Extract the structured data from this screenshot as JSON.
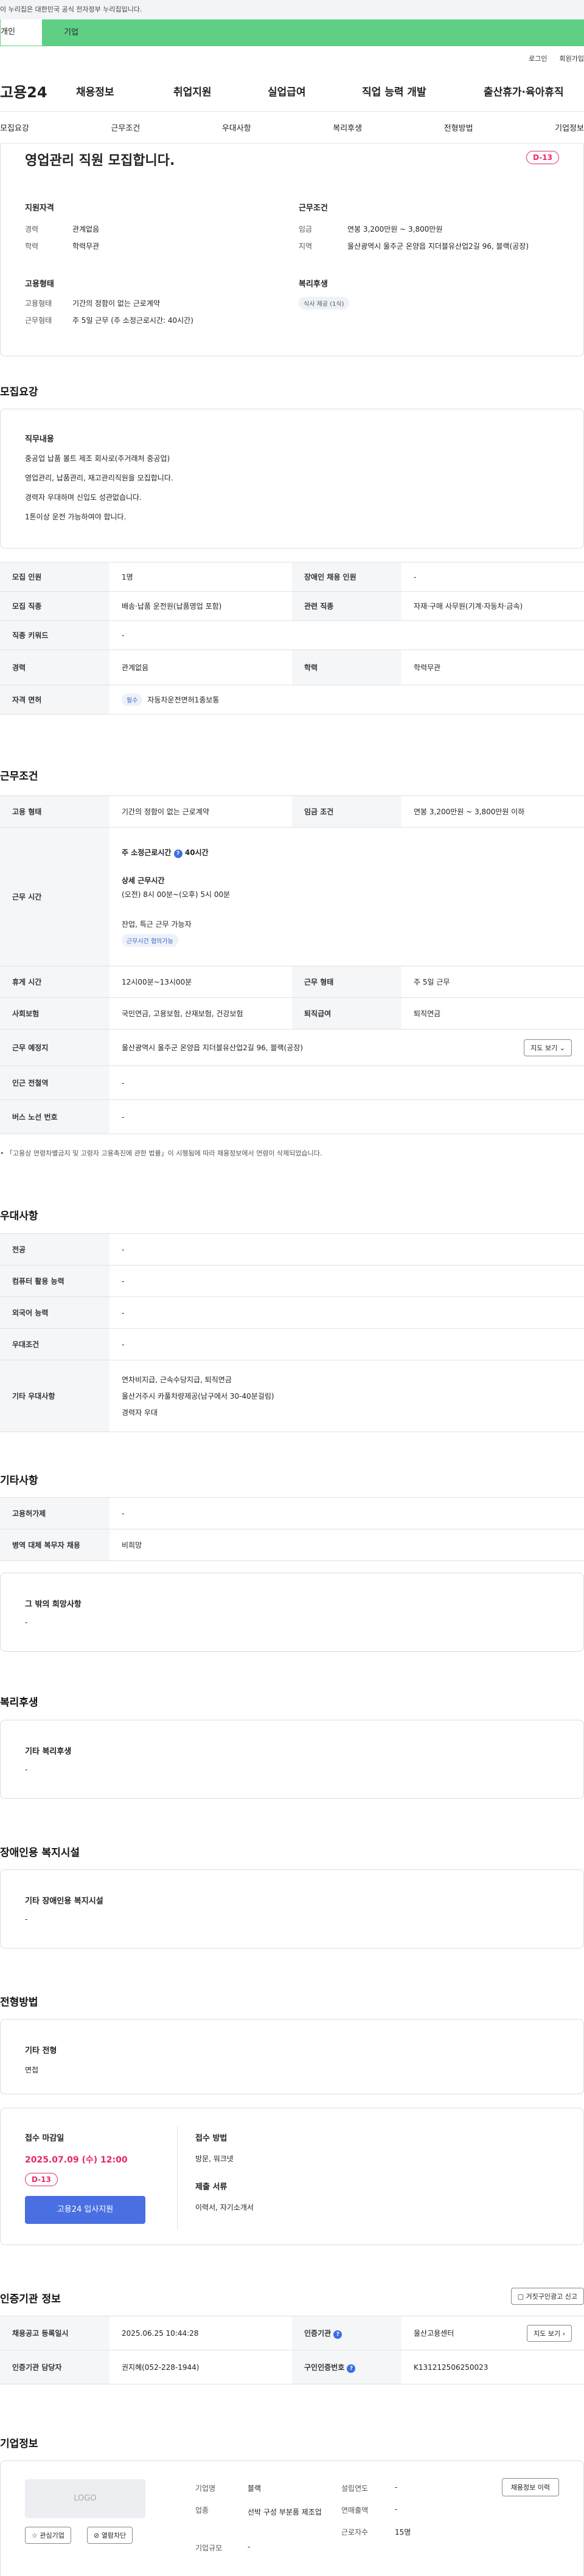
{
  "notice": "이 누리집은 대한민국 공식 전자정부 누리집입니다.",
  "user_tabs": {
    "individual": "개인",
    "enterprise": "기업"
  },
  "util": {
    "login": "로그인",
    "join": "회원가입"
  },
  "logo": "고용24",
  "gnb": [
    "채용정보",
    "취업지원",
    "실업급여",
    "직업 능력 개발",
    "출산휴가·육아휴직"
  ],
  "subnav": [
    "모집요강",
    "근무조건",
    "우대사항",
    "복리후생",
    "전형방법",
    "기업정보"
  ],
  "summary": {
    "title": "영업관리 직원 모집합니다.",
    "dday": "D-13",
    "qual_title": "지원자격",
    "qual": [
      {
        "k": "경력",
        "v": "관계없음"
      },
      {
        "k": "학력",
        "v": "학력무관"
      }
    ],
    "cond_title": "근무조건",
    "cond": [
      {
        "k": "임금",
        "v": "연봉 3,200만원 ~ 3,800만원"
      },
      {
        "k": "지역",
        "v": "울산광역시 울주군 온양읍 지더블유산업2길 96, 블랙(공장)"
      }
    ],
    "emp_title": "고용형태",
    "emp": [
      {
        "k": "고용형태",
        "v": "기간의 정함이 없는 근로계약"
      },
      {
        "k": "근무형태",
        "v": "주 5일 근무 (주 소정근로시간: 40시간)"
      }
    ],
    "welfare_title": "복리후생",
    "welfare_chip": "식사 제공 (1식)"
  },
  "recruit": {
    "title": "모집요강",
    "duty_title": "직무내용",
    "duty_lines": [
      "중공업 납품 볼트 제조 회사로(주거래처 중공업)",
      "영업관리, 납품관리, 재고관리직원을 모집합니다.",
      "경력자 우대하며 신입도 성관없습니다.",
      "1톤이상 운전 가능하여야 합니다."
    ],
    "rows": {
      "count_k": "모집 인원",
      "count_v": "1명",
      "disabled_k": "장애인 채용 인원",
      "disabled_v": "-",
      "job_k": "모집 직종",
      "job_v": "배송·납품 운전원(납품영업 포함)",
      "rel_k": "관련 직종",
      "rel_v": "자재·구매 사무원(기계·자동차·금속)",
      "kw_k": "직종 키워드",
      "kw_v": "-",
      "career_k": "경력",
      "career_v": "관계없음",
      "edu_k": "학력",
      "edu_v": "학력무관",
      "lic_k": "자격 면허",
      "lic_chip": "필수",
      "lic_v": "자동차운전면허1종보통"
    }
  },
  "work": {
    "title": "근무조건",
    "emp_k": "고용 형태",
    "emp_v": "기간의 정함이 없는 근로계약",
    "wage_k": "임금 조건",
    "wage_v": "연봉 3,200만원 ~ 3,800만원 이하",
    "time_k": "근무 시간",
    "time_main": "주 소정근로시간",
    "time_hours": "40시간",
    "time_detail_title": "상세 근무시간",
    "time_detail": "(오전) 8시 00분~(오후) 5시 00분",
    "time_extra": "잔업, 특근 근무 가능자",
    "time_chip": "근무시간 협의가능",
    "break_k": "휴게 시간",
    "break_v": "12시00분~13시00분",
    "form_k": "근무 형태",
    "form_v": "주 5일 근무",
    "ins_k": "사회보험",
    "ins_v": "국민연금, 고용보험, 산재보험, 건강보험",
    "ret_k": "퇴직급여",
    "ret_v": "퇴직연금",
    "loc_k": "근무 예정지",
    "loc_v": "울산광역시 울주군 온양읍 지더블유산업2길 96, 블랙(공장)",
    "map_btn": "지도 보기",
    "sub_k": "인근 전철역",
    "sub_v": "-",
    "bus_k": "버스 노선 번호",
    "bus_v": "-",
    "note": "「고용상 연령차별금지 및 고령자 고용촉진에 관한 법률」이 시행됨에 따라 채용정보에서 연령이 삭제되었습니다."
  },
  "pref": {
    "title": "우대사항",
    "major_k": "전공",
    "major_v": "-",
    "pc_k": "컴퓨터 활용 능력",
    "pc_v": "-",
    "lang_k": "외국어 능력",
    "lang_v": "-",
    "cond_k": "우대조건",
    "cond_v": "-",
    "etc_k": "기타 우대사항",
    "etc_lines": [
      "연차비지급, 근속수당지급, 퇴직연금",
      "울산거주시 카풀차량제공(남구에서 30-40분걸림)",
      "경력자 우대"
    ]
  },
  "other": {
    "title": "기타사항",
    "disab_k": "고용허가제",
    "disab_v": "-",
    "mil_k": "병역 대체 복무자 채용",
    "mil_v": "비희망",
    "hope_title": "그 밖의 희망사항",
    "hope_v": "-"
  },
  "welfare": {
    "title": "복리후생",
    "etc_title": "기타 복리후생",
    "etc_v": "-"
  },
  "disabled": {
    "title": "장애인용 복지시설",
    "etc_title": "기타 장애인용 복지시설",
    "etc_v": "-"
  },
  "selection": {
    "title": "전형방법",
    "etc_title": "기타 전형",
    "etc_v": "면접",
    "deadline_title": "접수 마감일",
    "deadline_v": "2025.07.09 (수) 12:00",
    "dday": "D-13",
    "apply_btn": "고용24 입사지원",
    "method_title": "접수 방법",
    "method_v": "방문, 워크넷",
    "docs_title": "제출 서류",
    "docs_v": "이력서, 자기소개서"
  },
  "agency": {
    "title": "인증기관 정보",
    "report_btn": "거짓구인광고 신고",
    "reg_k": "채용공고 등록일시",
    "reg_v": "2025.06.25 10:44:28",
    "org_k": "인증기관",
    "org_v": "울산고용센터",
    "map_btn": "지도 보기",
    "mgr_k": "인증기관 담당자",
    "mgr_v": "권지혜(052-228-1944)",
    "num_k": "구인인증번호",
    "num_v": "K131212506250023"
  },
  "company": {
    "title": "기업정보",
    "logo": "LOGO",
    "fav_btn": "관심기업",
    "block_btn": "열람차단",
    "rows": [
      {
        "k": "기업명",
        "v": "블랙"
      },
      {
        "k": "업종",
        "v": "선박 구성 부분품 제조업"
      },
      {
        "k": "기업규모",
        "v": "-"
      }
    ],
    "rows2": [
      {
        "k": "설립연도",
        "v": "-"
      },
      {
        "k": "연매출액",
        "v": "-"
      },
      {
        "k": "근로자수",
        "v": "15명"
      }
    ],
    "history_btn": "채용정보 이력"
  }
}
